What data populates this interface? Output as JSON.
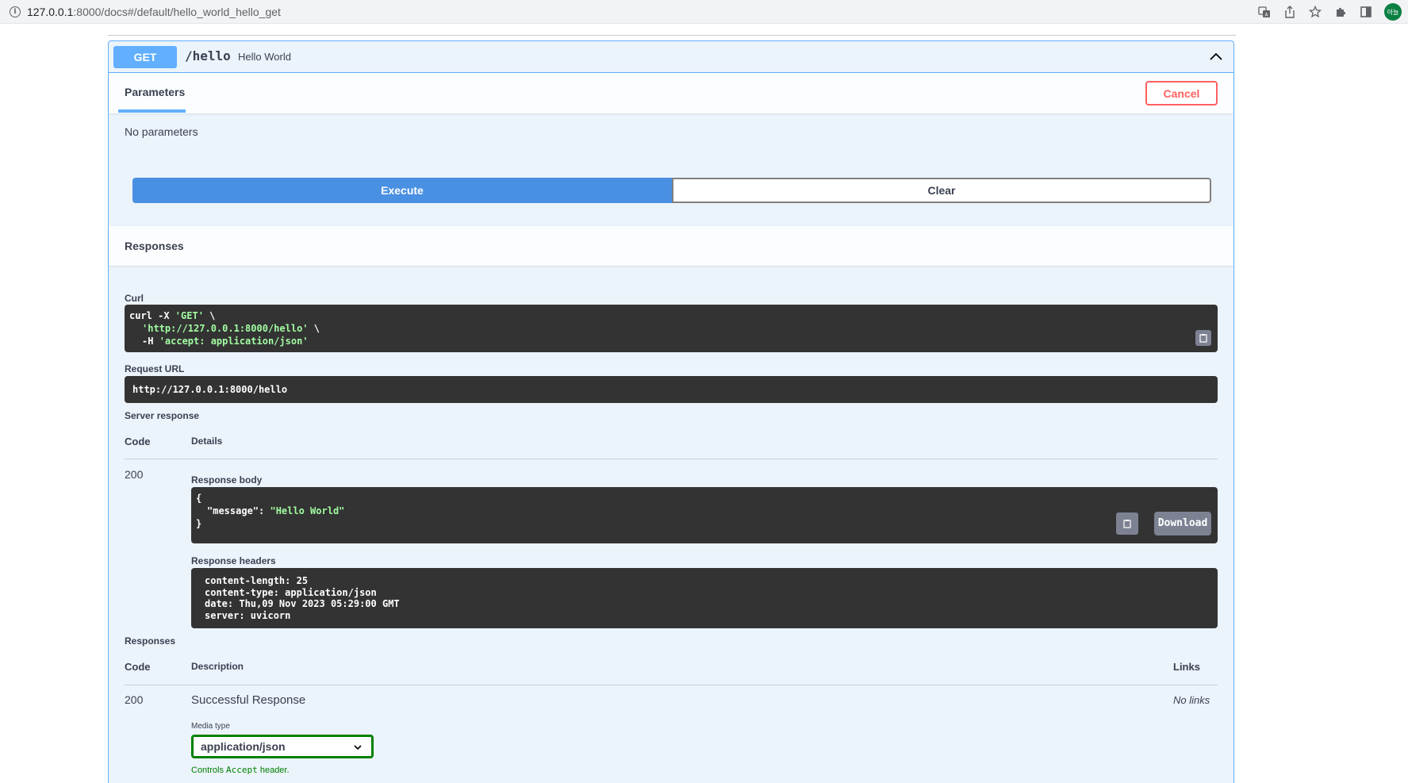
{
  "browser": {
    "url_host": "127.0.0.1",
    "url_path": ":8000/docs#/default/hello_world_hello_get",
    "avatar_text": "아늘"
  },
  "operation": {
    "method": "GET",
    "path": "/hello",
    "summary": "Hello World"
  },
  "parameters": {
    "tab_label": "Parameters",
    "cancel_label": "Cancel",
    "empty_text": "No parameters"
  },
  "actions": {
    "execute_label": "Execute",
    "clear_label": "Clear"
  },
  "responses_section": {
    "title": "Responses",
    "curl_label": "Curl",
    "curl_lines": {
      "l1_cmd": "curl -X ",
      "l1_str": "'GET'",
      "l1_end": " \\",
      "l2_str": "'http://127.0.0.1:8000/hello'",
      "l2_end": " \\",
      "l3_cmd": "-H ",
      "l3_str": "'accept: application/json'"
    },
    "request_url_label": "Request URL",
    "request_url": "http://127.0.0.1:8000/hello",
    "server_response_label": "Server response",
    "code_header": "Code",
    "details_header": "Details",
    "code": "200",
    "response_body_label": "Response body",
    "body": {
      "open": "{",
      "key": "\"message\"",
      "colon": ": ",
      "value": "\"Hello World\"",
      "close": "}"
    },
    "download_label": "Download",
    "response_headers_label": "Response headers",
    "headers": [
      "content-length: 25",
      "content-type: application/json",
      "date: Thu,09 Nov 2023 05:29:00 GMT",
      "server: uvicorn"
    ]
  },
  "responses_table": {
    "title": "Responses",
    "code_header": "Code",
    "description_header": "Description",
    "links_header": "Links",
    "row": {
      "code": "200",
      "description": "Successful Response",
      "links": "No links",
      "media_type_label": "Media type",
      "media_type_value": "application/json",
      "controls_prefix": "Controls ",
      "controls_code": "Accept",
      "controls_suffix": " header."
    }
  },
  "colors": {
    "get_blue": "#61affe",
    "execute_blue": "#4990e2",
    "cancel_red": "#ff6060",
    "code_bg": "#333333",
    "string_green": "#a2fca2",
    "media_green": "#008000"
  }
}
